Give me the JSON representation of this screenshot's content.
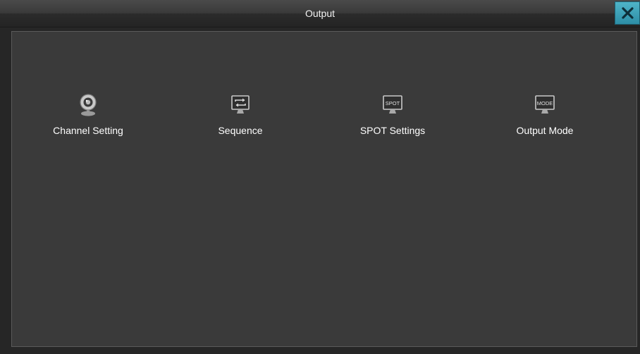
{
  "window": {
    "title": "Output",
    "close_icon": "close-icon"
  },
  "menu": {
    "items": [
      {
        "label": "Channel Setting",
        "icon": "webcam-icon"
      },
      {
        "label": "Sequence",
        "icon": "sequence-monitor-icon"
      },
      {
        "label": "SPOT Settings",
        "icon": "spot-monitor-icon",
        "icon_text": "SPOT"
      },
      {
        "label": "Output Mode",
        "icon": "mode-monitor-icon",
        "icon_text": "MODE"
      }
    ]
  },
  "colors": {
    "background": "#3a3a3a",
    "titlebar": "#3a3a3a",
    "close_button": "#2d8ea6",
    "text": "#ffffff"
  }
}
